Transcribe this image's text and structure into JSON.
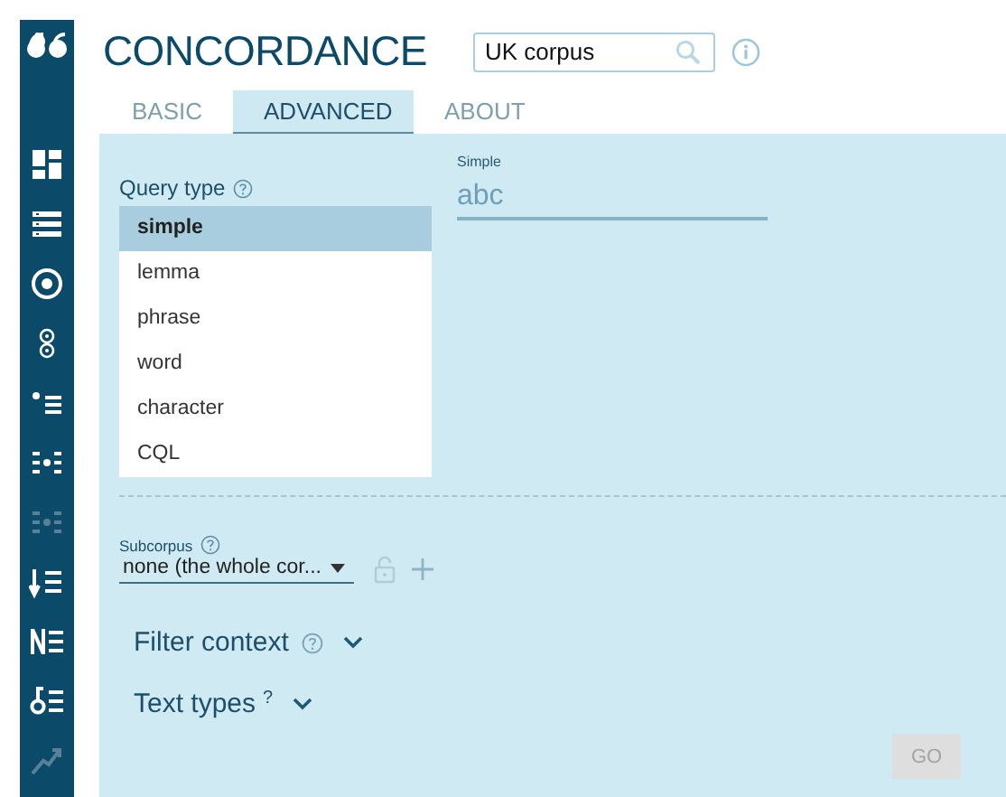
{
  "app": {
    "title": "CONCORDANCE"
  },
  "corpus_search": {
    "value": "UK corpus"
  },
  "sidebar": {
    "items": [
      {
        "disabled": false
      },
      {
        "disabled": false
      },
      {
        "disabled": false
      },
      {
        "disabled": false
      },
      {
        "disabled": false
      },
      {
        "disabled": false
      },
      {
        "disabled": true
      },
      {
        "disabled": false
      },
      {
        "disabled": false
      },
      {
        "disabled": false
      },
      {
        "disabled": true
      }
    ]
  },
  "tabs": [
    {
      "label": "BASIC",
      "selected": false
    },
    {
      "label": "ADVANCED",
      "selected": true
    },
    {
      "label": "ABOUT",
      "selected": false
    }
  ],
  "query_type": {
    "label": "Query type",
    "options": [
      {
        "label": "simple",
        "selected": true
      },
      {
        "label": "lemma",
        "selected": false
      },
      {
        "label": "phrase",
        "selected": false
      },
      {
        "label": "word",
        "selected": false
      },
      {
        "label": "character",
        "selected": false
      },
      {
        "label": "CQL",
        "selected": false
      }
    ]
  },
  "simple_field": {
    "label": "Simple",
    "placeholder": "abc"
  },
  "subcorpus": {
    "label": "Subcorpus",
    "value": "none (the whole cor..."
  },
  "sections": [
    {
      "label": "Filter context",
      "kind": "icon",
      "expanded": false
    },
    {
      "label": "Text types",
      "kind": "mark",
      "help_text": "?",
      "expanded": false
    }
  ],
  "go_button": {
    "label": "GO",
    "disabled": true
  }
}
